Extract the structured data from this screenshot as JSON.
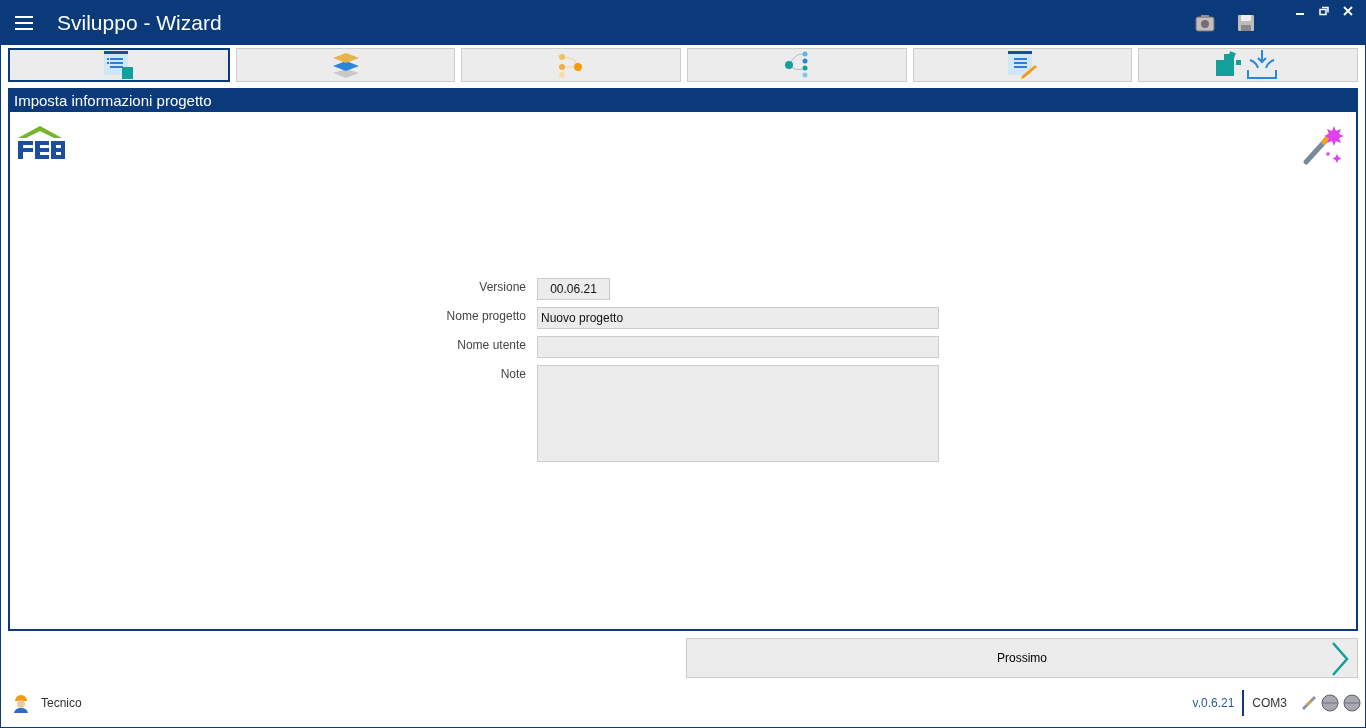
{
  "window": {
    "title": "Sviluppo - Wizard"
  },
  "tabs": [
    {
      "kind": "info",
      "selected": true
    },
    {
      "kind": "layers",
      "selected": false
    },
    {
      "kind": "branch",
      "selected": false
    },
    {
      "kind": "nodes",
      "selected": false
    },
    {
      "kind": "edit",
      "selected": false
    },
    {
      "kind": "import",
      "selected": false
    }
  ],
  "panel": {
    "title": "Imposta informazioni progetto"
  },
  "fields": [
    {
      "kind": "short",
      "label": "Versione",
      "value": "00.06.21"
    },
    {
      "kind": "line",
      "label": "Nome progetto",
      "value": "Nuovo progetto"
    },
    {
      "kind": "line",
      "label": "Nome utente"
    },
    {
      "kind": "area",
      "label": "Note"
    }
  ],
  "next_button": {
    "label": "Prossimo"
  },
  "status_bar": {
    "user": "Tecnico",
    "version": "v.0.6.21",
    "port": "COM3"
  }
}
